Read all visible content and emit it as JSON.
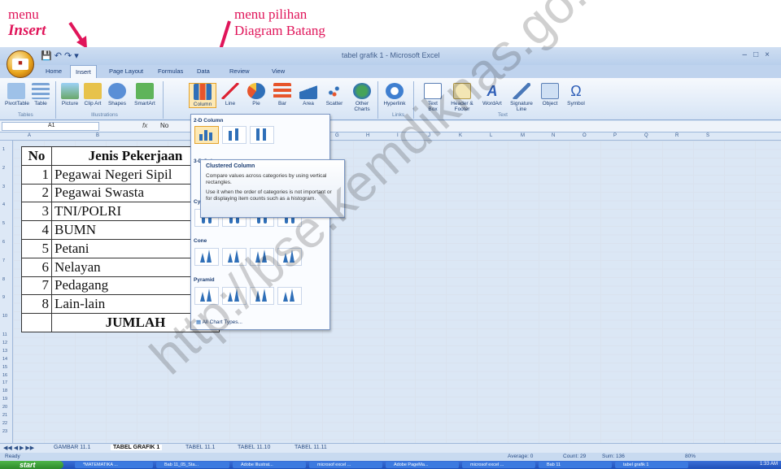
{
  "annotations": {
    "menu": "menu",
    "insert": "Insert",
    "menu_pilihan": "menu  pilihan",
    "diagram": "Diagram Batang"
  },
  "window": {
    "title": "tabel grafik 1 - Microsoft Excel",
    "office_label": "Office"
  },
  "tabs": [
    "Home",
    "Insert",
    "Page Layout",
    "Formulas",
    "Data",
    "Review",
    "View"
  ],
  "ribbon": {
    "tables": [
      "PivotTable",
      "Table"
    ],
    "illustrations": [
      "Picture",
      "Clip Art",
      "Shapes",
      "SmartArt"
    ],
    "charts": [
      "Column",
      "Line",
      "Pie",
      "Bar",
      "Area",
      "Scatter",
      "Other Charts"
    ],
    "links": [
      "Hyperlink"
    ],
    "text": [
      "Text Box",
      "Header & Footer",
      "WordArt",
      "Signature Line",
      "Object",
      "Symbol"
    ],
    "groups": {
      "tables": "Tables",
      "illustrations": "Illustrations",
      "links": "Links",
      "text": "Text"
    }
  },
  "formula": {
    "cell": "A1",
    "fx": "fx",
    "value": "No"
  },
  "columns": [
    "A",
    "B",
    "C",
    "D",
    "E",
    "F",
    "G",
    "H",
    "I",
    "J",
    "K",
    "L",
    "M",
    "N",
    "O",
    "P",
    "Q",
    "R",
    "S"
  ],
  "rows": [
    "1",
    "2",
    "3",
    "4",
    "5",
    "6",
    "7",
    "8",
    "9",
    "10",
    "11",
    "12",
    "13",
    "14",
    "15",
    "16",
    "17",
    "18",
    "19",
    "20",
    "21",
    "22",
    "23"
  ],
  "table": {
    "header": {
      "no": "No",
      "job": "Jenis Pekerjaan"
    },
    "rows": [
      {
        "no": "1",
        "job": "Pegawai Negeri Sipil"
      },
      {
        "no": "2",
        "job": "Pegawai Swasta"
      },
      {
        "no": "3",
        "job": "TNI/POLRI"
      },
      {
        "no": "4",
        "job": "BUMN"
      },
      {
        "no": "5",
        "job": "Petani"
      },
      {
        "no": "6",
        "job": "Nelayan"
      },
      {
        "no": "7",
        "job": "Pedagang"
      },
      {
        "no": "8",
        "job": "Lain-lain"
      }
    ],
    "total": "JUMLAH"
  },
  "dropdown": {
    "sections": [
      "2-D Column",
      "3-D Column",
      "Cylinder",
      "Cone",
      "Pyramid"
    ],
    "all_types": "All Chart Types..."
  },
  "tooltip": {
    "title": "Clustered Column",
    "line1": "Compare values across categories by using vertical rectangles.",
    "line2": "Use it when the order of categories is not important or for displaying item counts such as a histogram."
  },
  "sheets": [
    "GAMBAR 11.1",
    "TABEL GRAFIK 1",
    "TABEL 11.1",
    "TABEL 11.10",
    "TABEL 11.11"
  ],
  "status": {
    "ready": "Ready",
    "average": "Average: 0",
    "count": "Count: 29",
    "sum": "Sum: 136",
    "zoom": "80%"
  },
  "taskbar": {
    "start": "start",
    "items": [
      "*MATEMATIKA ...",
      "Bab 11_05_Sta...",
      "Adobe Illustrat...",
      "microsof excel ...",
      "Adobe PageMa...",
      "microsof excel ...",
      "Bab 11",
      "tabel grafik 1"
    ],
    "clock": "1:33 AM"
  },
  "watermark": "http://bse.kemdiknas.go.id",
  "colors": {
    "annotation": "#e0155a",
    "excel_blue": "#dbe7f5",
    "taskbar": "#2a5fcf"
  }
}
